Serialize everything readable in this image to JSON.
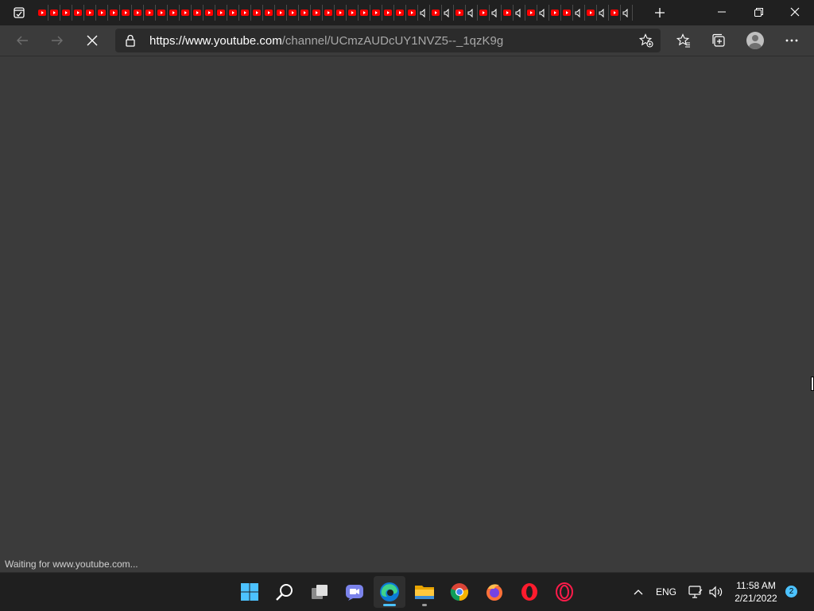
{
  "browser": {
    "tab_count_youtube": 50,
    "tab_speaker_positions": [
      33,
      35,
      37,
      39,
      41,
      43,
      46,
      48,
      50
    ],
    "address": {
      "host": "https://www.youtube.com",
      "path": "/channel/UCmzAUDcUY1NVZ5--_1qzK9g"
    },
    "status_text": "Waiting for www.youtube.com..."
  },
  "icons": {
    "tab_actions": "tab-actions-icon",
    "new_tab": "plus-icon",
    "minimize": "minimize-icon",
    "restore": "restore-icon",
    "close": "close-icon",
    "back": "back-arrow-icon",
    "forward": "forward-arrow-icon",
    "stop": "stop-loading-icon",
    "lock": "lock-icon",
    "add_favorite": "add-favorite-icon",
    "favorites": "favorites-icon",
    "collections": "collections-icon",
    "profile": "profile-icon",
    "more": "more-icon"
  },
  "taskbar": {
    "apps": [
      "windows-start",
      "search",
      "task-view",
      "teams-chat",
      "edge",
      "file-explorer",
      "chrome",
      "firefox",
      "opera",
      "opera-gx"
    ],
    "language": "ENG",
    "time": "11:58 AM",
    "date": "2/21/2022",
    "notification_count": "2"
  },
  "colors": {
    "youtube_red": "#ff0000",
    "accent": "#4cc2ff"
  }
}
